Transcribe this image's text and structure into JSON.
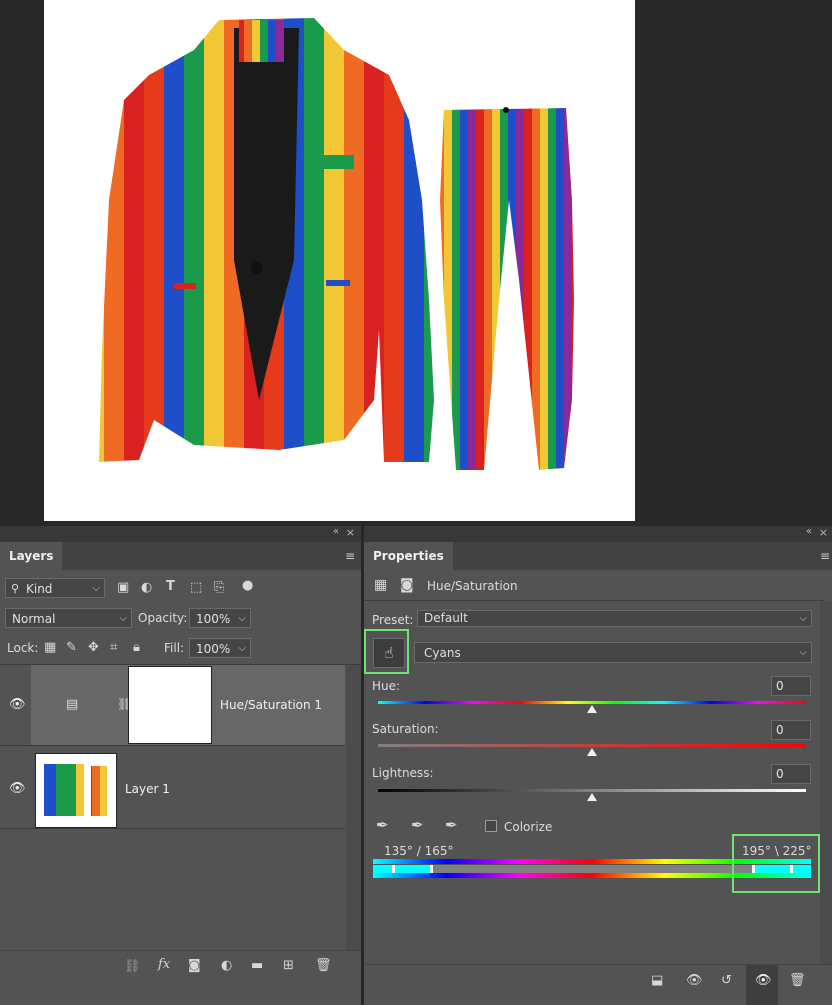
{
  "layers_panel": {
    "tab": "Layers",
    "kind_filter": "Kind",
    "blend_mode": "Normal",
    "opacity_label": "Opacity:",
    "opacity_value": "100%",
    "lock_label": "Lock:",
    "fill_label": "Fill:",
    "fill_value": "100%",
    "layers": [
      {
        "name": "Hue/Saturation 1",
        "visible": true,
        "selected": true
      },
      {
        "name": "Layer 1",
        "visible": true,
        "selected": false
      }
    ]
  },
  "properties_panel": {
    "tab": "Properties",
    "adjustment_title": "Hue/Saturation",
    "preset_label": "Preset:",
    "preset_value": "Default",
    "channel_value": "Cyans",
    "hue_label": "Hue:",
    "hue_value": "0",
    "saturation_label": "Saturation:",
    "saturation_value": "0",
    "lightness_label": "Lightness:",
    "lightness_value": "0",
    "colorize_label": "Colorize",
    "range_left": "135° / 165°",
    "range_right": "195° \\ 225°"
  },
  "colors": {
    "highlight": "#6fe36f",
    "panel_bg": "#535353"
  }
}
